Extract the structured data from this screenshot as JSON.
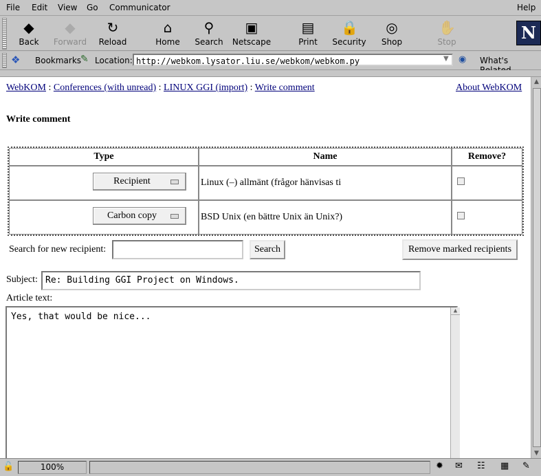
{
  "menu": [
    "File",
    "Edit",
    "View",
    "Go",
    "Communicator"
  ],
  "menu_help": "Help",
  "toolbar": [
    {
      "label": "Back",
      "icon": "back-icon",
      "glyph": "◆",
      "enabled": true
    },
    {
      "label": "Forward",
      "icon": "forward-icon",
      "glyph": "◆",
      "enabled": false
    },
    {
      "label": "Reload",
      "icon": "reload-icon",
      "glyph": "↻",
      "enabled": true
    },
    {
      "label": "Home",
      "icon": "home-icon",
      "glyph": "⌂",
      "enabled": true
    },
    {
      "label": "Search",
      "icon": "search-icon",
      "glyph": "⚲",
      "enabled": true
    },
    {
      "label": "Netscape",
      "icon": "netscape-icon",
      "glyph": "▣",
      "enabled": true
    },
    {
      "label": "Print",
      "icon": "print-icon",
      "glyph": "▤",
      "enabled": true
    },
    {
      "label": "Security",
      "icon": "security-icon",
      "glyph": "🔒",
      "enabled": true
    },
    {
      "label": "Shop",
      "icon": "shop-icon",
      "glyph": "◎",
      "enabled": true
    },
    {
      "label": "Stop",
      "icon": "stop-icon",
      "glyph": "✋",
      "enabled": false
    }
  ],
  "logo": "N",
  "location": {
    "bookmarks_label": "Bookmarks",
    "location_label": "Location:",
    "url": "http://webkom.lysator.liu.se/webkom/webkom.py",
    "related_label": "What's Related"
  },
  "breadcrumb": {
    "home": "WebKOM",
    "sep": ":",
    "conferences": "Conferences (with unread)",
    "conference": "LINUX GGI (import)",
    "current": "Write comment"
  },
  "about_link": "About WebKOM",
  "page_title": "Write comment",
  "recipients_table": {
    "headers": [
      "Type",
      "Name",
      "Remove?"
    ],
    "rows": [
      {
        "type": "Recipient",
        "name": "Linux (–) allmänt (frågor hänvisas ti"
      },
      {
        "type": "Carbon copy",
        "name": "BSD Unix (en bättre Unix än Unix?)"
      }
    ]
  },
  "search": {
    "label": "Search for new recipient:",
    "value": "",
    "button": "Search"
  },
  "remove_button": "Remove marked recipients",
  "subject": {
    "label": "Subject:",
    "value": "Re: Building GGI Project on Windows."
  },
  "article": {
    "label": "Article text:",
    "value": "Yes, that would be nice..."
  },
  "status": {
    "zoom": "100%"
  }
}
